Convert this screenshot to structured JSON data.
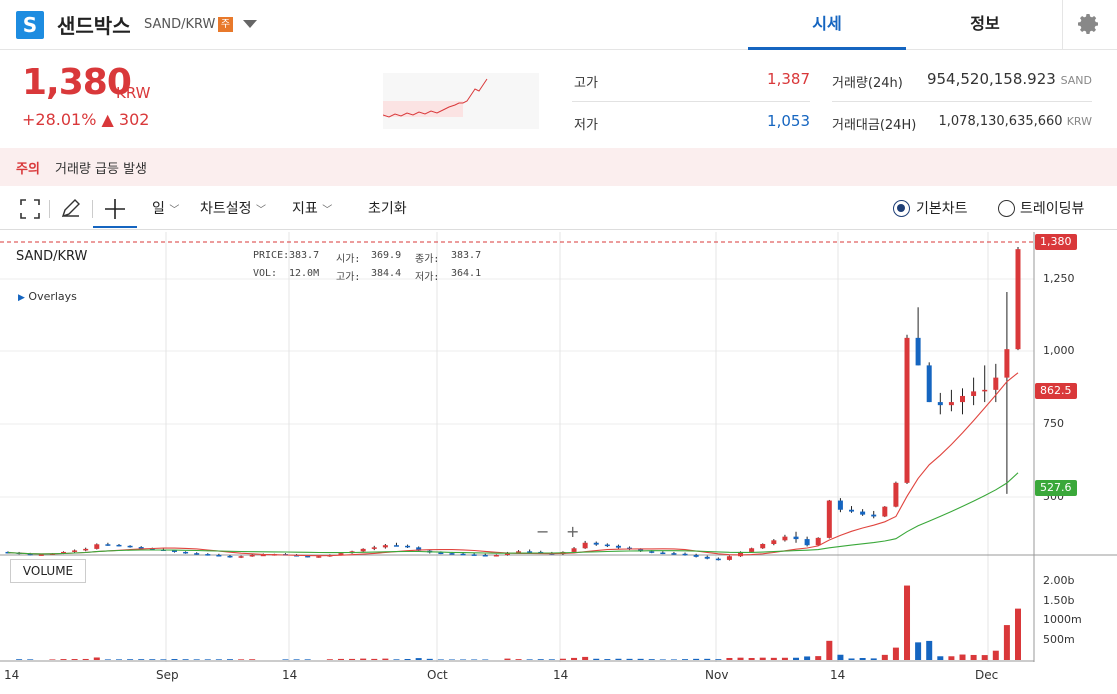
{
  "header": {
    "logo_letter": "S",
    "coin_name": "샌드박스",
    "pair": "SAND/KRW",
    "warn_badge": "주",
    "tab_market": "시세",
    "tab_info": "정보"
  },
  "price": {
    "current": "1,380",
    "unit": "KRW",
    "change_pct": "+28.01%",
    "change_abs": "▲ 302"
  },
  "stats": {
    "high_label": "고가",
    "high_value": "1,387",
    "low_label": "저가",
    "low_value": "1,053",
    "volume_label": "거래량(24h)",
    "volume_value": "954,520,158.923",
    "volume_unit": "SAND",
    "amount_label": "거래대금(24H)",
    "amount_value": "1,078,130,635,660",
    "amount_unit": "KRW"
  },
  "alert": {
    "tag": "주의",
    "text": "거래량 급등 발생"
  },
  "toolbar": {
    "period": "일",
    "chart_settings": "차트설정",
    "indicators": "지표",
    "reset": "초기화",
    "basic_chart": "기본차트",
    "trading_view": "트레이딩뷰"
  },
  "chart_info": {
    "symbol": "SAND/KRW",
    "price_label": "PRICE:",
    "price_value": "383.7",
    "open_label": "시가:",
    "open_value": "369.9",
    "close_label": "종가:",
    "close_value": "383.7",
    "vol_label": "VOL:",
    "vol_value": "12.0M",
    "high_label": "고가:",
    "high_value": "384.4",
    "low_label": "저가:",
    "low_value": "364.1",
    "overlays": "Overlays",
    "volume_button": "VOLUME"
  },
  "colors": {
    "up": "#d9383a",
    "down": "#1565c0",
    "ma_short": "#e0453f",
    "ma_long": "#3aa83a",
    "accent": "#1565c0"
  },
  "chart_data": {
    "type": "candlestick",
    "x_ticks": [
      "14",
      "Sep",
      "14",
      "Oct",
      "14",
      "Nov",
      "14",
      "Dec"
    ],
    "y_ticks": [
      "1,250",
      "1,000",
      "750",
      "500"
    ],
    "volume_ticks": [
      "2.00b",
      "1.50b",
      "1000m",
      "500m"
    ],
    "current_price_tag": "1,380",
    "ma_short_tag": "862.5",
    "ma_long_tag": "527.6",
    "ylim": [
      380,
      1410
    ],
    "candles": [
      [
        390,
        392,
        385,
        388
      ],
      [
        388,
        390,
        382,
        384
      ],
      [
        384,
        387,
        379,
        381
      ],
      [
        381,
        384,
        378,
        382
      ],
      [
        382,
        386,
        380,
        385
      ],
      [
        385,
        392,
        383,
        390
      ],
      [
        390,
        398,
        388,
        395
      ],
      [
        395,
        404,
        392,
        400
      ],
      [
        400,
        418,
        398,
        415
      ],
      [
        415,
        420,
        410,
        413
      ],
      [
        413,
        416,
        408,
        410
      ],
      [
        410,
        412,
        404,
        406
      ],
      [
        406,
        409,
        400,
        402
      ],
      [
        402,
        404,
        396,
        398
      ],
      [
        398,
        401,
        393,
        395
      ],
      [
        395,
        398,
        388,
        390
      ],
      [
        390,
        392,
        384,
        386
      ],
      [
        386,
        389,
        381,
        383
      ],
      [
        383,
        386,
        378,
        380
      ],
      [
        380,
        384,
        375,
        377
      ],
      [
        377,
        380,
        371,
        373
      ],
      [
        373,
        378,
        370,
        376
      ],
      [
        376,
        382,
        374,
        380
      ],
      [
        380,
        385,
        377,
        381
      ],
      [
        381,
        384,
        378,
        383
      ],
      [
        383,
        386,
        379,
        380
      ],
      [
        380,
        383,
        375,
        377
      ],
      [
        377,
        380,
        372,
        374
      ],
      [
        374,
        378,
        371,
        376
      ],
      [
        376,
        382,
        374,
        380
      ],
      [
        380,
        388,
        378,
        386
      ],
      [
        386,
        394,
        384,
        392
      ],
      [
        392,
        402,
        390,
        400
      ],
      [
        400,
        410,
        396,
        405
      ],
      [
        405,
        416,
        401,
        412
      ],
      [
        412,
        420,
        408,
        410
      ],
      [
        410,
        414,
        403,
        405
      ],
      [
        405,
        408,
        392,
        394
      ],
      [
        394,
        397,
        385,
        388
      ],
      [
        388,
        392,
        383,
        386
      ],
      [
        386,
        390,
        382,
        384
      ],
      [
        384,
        388,
        380,
        382
      ],
      [
        382,
        386,
        378,
        380
      ],
      [
        380,
        384,
        376,
        378
      ],
      [
        378,
        382,
        375,
        380
      ],
      [
        380,
        390,
        378,
        388
      ],
      [
        388,
        396,
        385,
        392
      ],
      [
        392,
        398,
        387,
        390
      ],
      [
        390,
        394,
        385,
        386
      ],
      [
        386,
        390,
        381,
        383
      ],
      [
        383,
        392,
        380,
        390
      ],
      [
        390,
        406,
        388,
        402
      ],
      [
        402,
        426,
        400,
        420
      ],
      [
        420,
        424,
        410,
        414
      ],
      [
        414,
        418,
        406,
        410
      ],
      [
        410,
        414,
        400,
        404
      ],
      [
        404,
        408,
        396,
        398
      ],
      [
        398,
        402,
        390,
        392
      ],
      [
        392,
        396,
        386,
        388
      ],
      [
        388,
        392,
        383,
        386
      ],
      [
        386,
        390,
        381,
        384
      ],
      [
        384,
        388,
        378,
        380
      ],
      [
        380,
        384,
        372,
        374
      ],
      [
        374,
        378,
        366,
        368
      ],
      [
        368,
        372,
        362,
        364
      ],
      [
        364,
        378,
        362,
        376
      ],
      [
        376,
        392,
        374,
        390
      ],
      [
        390,
        404,
        388,
        402
      ],
      [
        402,
        418,
        400,
        416
      ],
      [
        416,
        432,
        412,
        428
      ],
      [
        428,
        446,
        424,
        440
      ],
      [
        440,
        456,
        420,
        432
      ],
      [
        432,
        440,
        408,
        412
      ],
      [
        412,
        438,
        410,
        436
      ],
      [
        436,
        560,
        434,
        558
      ],
      [
        558,
        566,
        520,
        528
      ],
      [
        528,
        540,
        518,
        522
      ],
      [
        522,
        530,
        508,
        512
      ],
      [
        512,
        524,
        500,
        506
      ],
      [
        506,
        540,
        504,
        538
      ],
      [
        538,
        620,
        536,
        616
      ],
      [
        616,
        1100,
        612,
        1090
      ],
      [
        1090,
        1190,
        1000,
        1000
      ],
      [
        1000,
        1010,
        880,
        880
      ],
      [
        880,
        910,
        840,
        870
      ],
      [
        870,
        920,
        850,
        880
      ],
      [
        880,
        925,
        840,
        900
      ],
      [
        900,
        960,
        870,
        915
      ],
      [
        915,
        1000,
        880,
        920
      ],
      [
        920,
        1005,
        880,
        960
      ],
      [
        960,
        1240,
        580,
        1053
      ],
      [
        1053,
        1387,
        1050,
        1380
      ]
    ]
  }
}
